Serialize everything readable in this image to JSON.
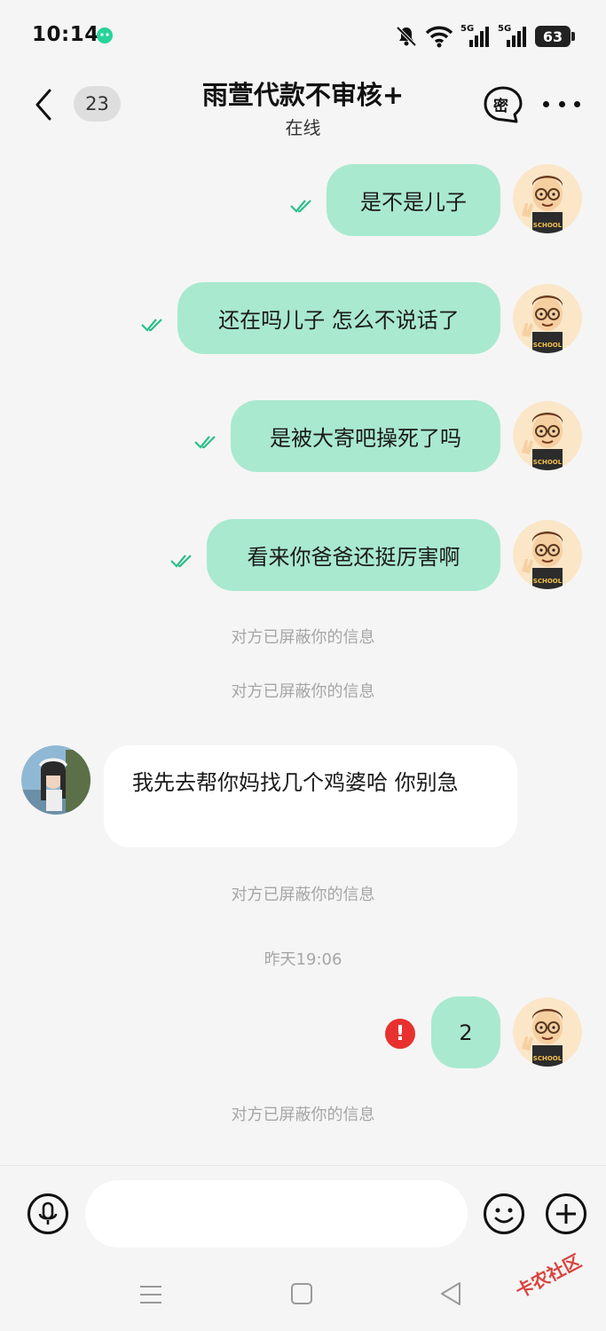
{
  "status_bar": {
    "time": "10:14",
    "signal_1_label": "5G",
    "signal_2_label": "5G",
    "battery": "63"
  },
  "header": {
    "unread_count": "23",
    "title": "雨萱代款不审核+",
    "status": "在线",
    "secret_label": "密"
  },
  "messages": [
    {
      "type": "out",
      "text": "是不是儿子",
      "read": true
    },
    {
      "type": "out",
      "text": "还在吗儿子 怎么不说话了",
      "read": true
    },
    {
      "type": "out",
      "text": "是被大寄吧操死了吗",
      "read": true
    },
    {
      "type": "out",
      "text": "看来你爸爸还挺厉害啊",
      "read": true
    },
    {
      "type": "system",
      "text": "对方已屏蔽你的信息"
    },
    {
      "type": "system",
      "text": "对方已屏蔽你的信息"
    },
    {
      "type": "in",
      "text": "我先去帮你妈找几个鸡婆哈 你别急"
    },
    {
      "type": "system",
      "text": "对方已屏蔽你的信息"
    },
    {
      "type": "time",
      "text": "昨天19:06"
    },
    {
      "type": "out",
      "text": "2",
      "failed": true
    },
    {
      "type": "system",
      "text": "对方已屏蔽你的信息"
    }
  ],
  "input": {
    "value": "",
    "placeholder": ""
  },
  "watermark": "卡农社区",
  "colors": {
    "outgoing_bubble": "#a9e9cf",
    "incoming_bubble": "#ffffff",
    "read_tick": "#2bbf8a",
    "error": "#e8312f",
    "background": "#f5f5f5"
  }
}
